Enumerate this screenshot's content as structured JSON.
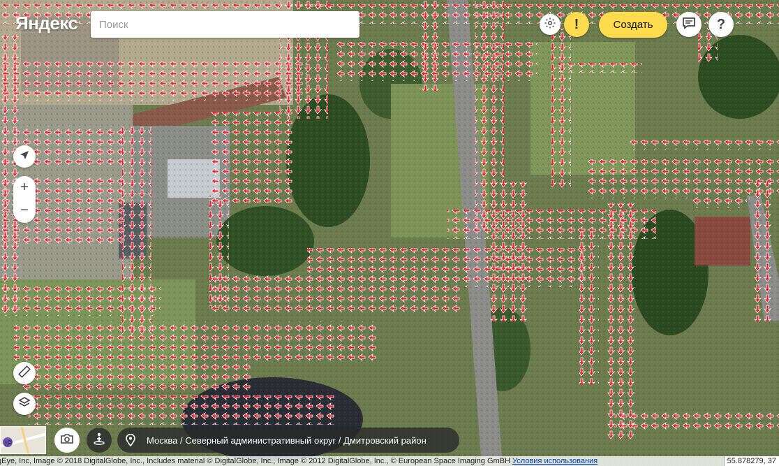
{
  "header": {
    "logo_text": "Яндекс",
    "search_placeholder": "Поиск",
    "create_label": "Создать",
    "icons": [
      "gear-icon",
      "warning-icon",
      "chat-icon",
      "help-icon"
    ],
    "accent_color": "#ffdb4d"
  },
  "controls": {
    "zoom_in": "+",
    "zoom_out": "−",
    "icons": [
      "locate-arrow-icon",
      "ruler-icon",
      "layers-icon",
      "camera-icon",
      "panorama-person-icon",
      "pin-icon"
    ]
  },
  "minimap": {
    "label": "IP"
  },
  "breadcrumb": {
    "text": "Москва / Северный административный округ / Дмитровский район"
  },
  "footer": {
    "copyright": "gEye, Inc, Image © 2018 DigitalGlobe, Inc., Includes material © DigitalGlobe, Inc., Image © 2012 DigitalGlobe, Inc., © European Space Imaging GmBH",
    "terms_link": "Условия использования",
    "coords": "55.878279, 37"
  },
  "map": {
    "type": "satellite",
    "overlay": "red direction arrows (traffic/route layer)",
    "overlay_color": "#e8202a"
  }
}
